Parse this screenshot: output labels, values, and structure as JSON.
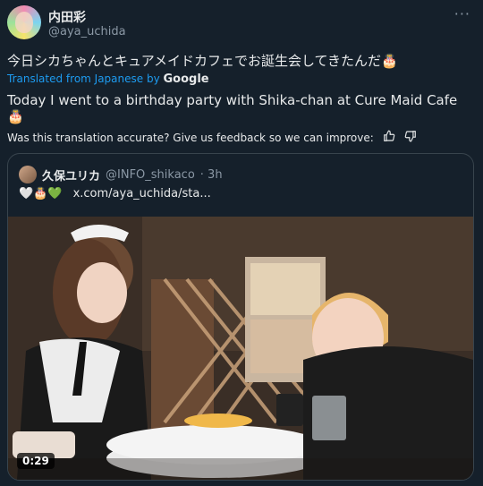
{
  "author": {
    "name": "内田彩",
    "handle": "@aya_uchida"
  },
  "more_label": "···",
  "tweet": {
    "original_text": "今日シカちゃんとキュアメイドカフェでお誕生会してきたんだ🎂",
    "translated_from": "Translated from Japanese by",
    "google": "Google",
    "translated_text": "Today I went to a birthday party with Shika-chan at Cure Maid Cafe 🎂",
    "feedback_prompt": "Was this translation accurate? Give us feedback so we can improve:"
  },
  "quote": {
    "name": "久保ユリカ",
    "handle": "@INFO_shikaco",
    "time": "· 3h",
    "emojis": "🤍🎂💚",
    "link": "x.com/aya_uchida/sta..."
  },
  "video": {
    "duration": "0:29"
  },
  "icons": {
    "like": "thumbs-up-icon",
    "dislike": "thumbs-down-icon",
    "more": "more-icon"
  }
}
